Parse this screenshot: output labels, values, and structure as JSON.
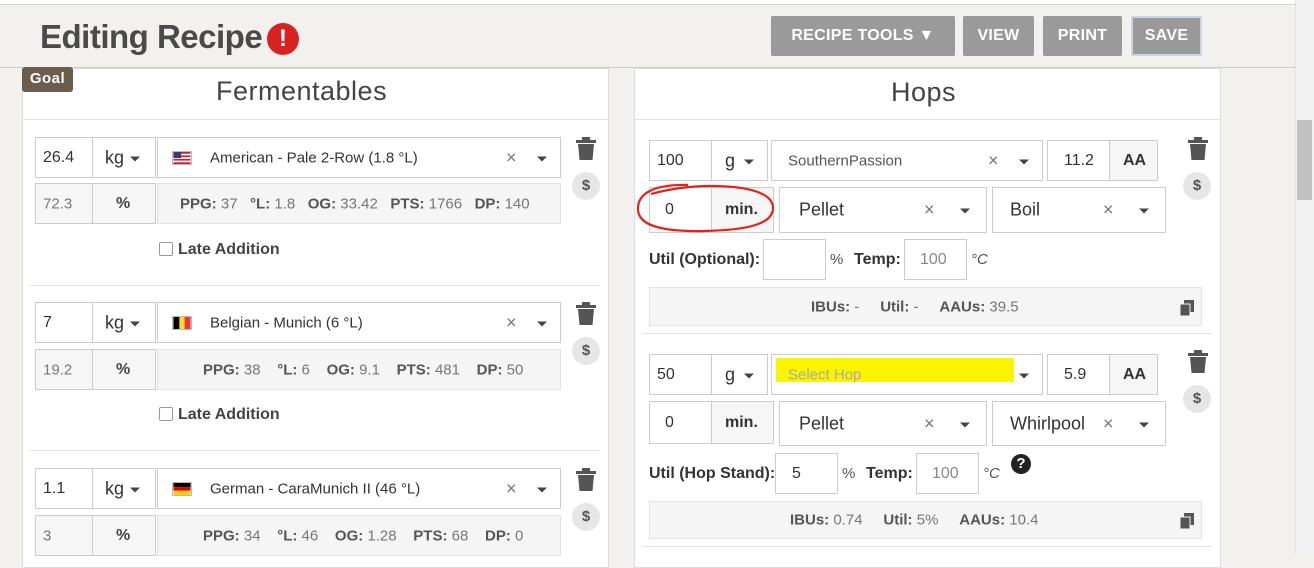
{
  "header": {
    "title": "Editing Recipe",
    "alert_symbol": "!",
    "buttons": {
      "recipe_tools": "RECIPE TOOLS ▼",
      "view": "VIEW",
      "print": "PRINT",
      "save": "SAVE"
    }
  },
  "colors": {
    "alert": "#d9211f",
    "goal_badge": "#6b5d4e",
    "button_grey": "#9a9a9a",
    "highlight_yellow": "#fbf400",
    "annotation_red": "#e2231a"
  },
  "fermentables": {
    "title": "Fermentables",
    "goal_label": "Goal",
    "late_addition_label": "Late Addition",
    "pct_unit": "%",
    "items": [
      {
        "amount": "26.4",
        "unit": "kg",
        "name": "American - Pale 2-Row (1.8 °L)",
        "flag": "us-flag-icon",
        "percent": "72.3",
        "ppg": "37",
        "l": "1.8",
        "og": "33.42",
        "pts": "1766",
        "dp": "140"
      },
      {
        "amount": "7",
        "unit": "kg",
        "name": "Belgian - Munich (6 °L)",
        "flag": "belgium-flag-icon",
        "percent": "19.2",
        "ppg": "38",
        "l": "6",
        "og": "9.1",
        "pts": "481",
        "dp": "50"
      },
      {
        "amount": "1.1",
        "unit": "kg",
        "name": "German - CaraMunich II (46 °L)",
        "flag": "germany-flag-icon",
        "percent": "3",
        "ppg": "34",
        "l": "46",
        "og": "1.28",
        "pts": "68",
        "dp": "0"
      }
    ]
  },
  "stat_labels": {
    "ppg": "PPG:",
    "l": "°L:",
    "og": "OG:",
    "pts": "PTS:",
    "dp": "DP:",
    "ibus": "IBUs:",
    "util": "Util:",
    "aaus": "AAUs:"
  },
  "hops": {
    "title": "Hops",
    "aa_label": "AA",
    "min_label": "min.",
    "temp_label": "Temp:",
    "temp_unit": "°C",
    "pct_unit": "%",
    "items": [
      {
        "amount": "100",
        "unit": "g",
        "name": "SouthernPassion",
        "aa": "11.2",
        "time": "0",
        "form": "Pellet",
        "use": "Boil",
        "util_label": "Util (Optional):",
        "util_value": "",
        "temp": "100",
        "ibus": "-",
        "util": "-",
        "aaus": "39.5"
      },
      {
        "amount": "50",
        "unit": "g",
        "name_placeholder": "Select Hop",
        "aa": "5.9",
        "time": "0",
        "form": "Pellet",
        "use": "Whirlpool",
        "util_label": "Util (Hop Stand):",
        "util_value": "5",
        "temp": "100",
        "ibus": "0.74",
        "util": "5%",
        "aaus": "10.4"
      }
    ]
  }
}
